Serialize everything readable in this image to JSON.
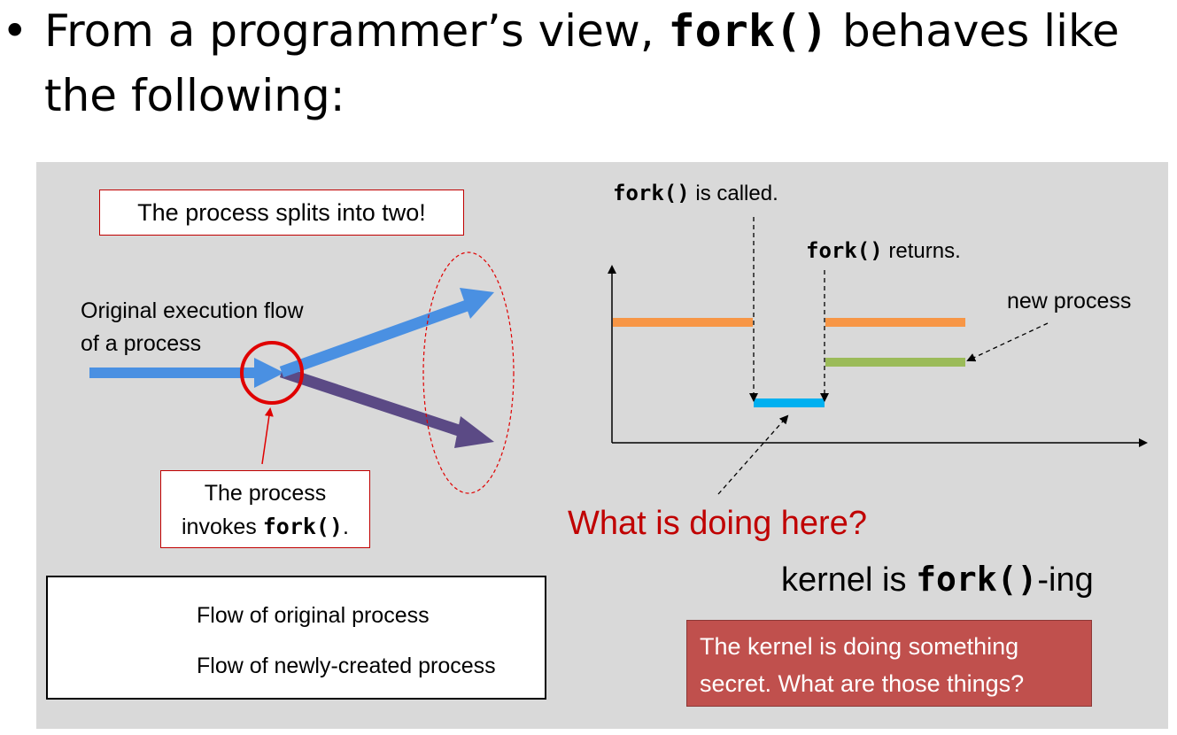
{
  "title": {
    "bullet": "•",
    "line1_prefix": "From a programmer’s view, ",
    "line1_code": "fork()",
    "line1_suffix": " behaves like",
    "line2": "the following:"
  },
  "left": {
    "split_box": "The process splits into two!",
    "flow_label_1": "Original execution flow",
    "flow_label_2": "of a process",
    "invoke_line1": "The process",
    "invoke_prefix": "invokes ",
    "invoke_code": "fork()",
    "invoke_suffix": "."
  },
  "legend": {
    "items": [
      {
        "label": "Flow of original process",
        "color": "#4a90e2"
      },
      {
        "label": "Flow of newly-created process",
        "color": "#c0504d"
      }
    ]
  },
  "timeline": {
    "called_code": "fork()",
    "called_text": " is called.",
    "returns_code": "fork()",
    "returns_text": " returns.",
    "new_process": "new process",
    "question": "What is doing here?",
    "answer_prefix": "kernel is ",
    "answer_code": "fork()",
    "answer_suffix": "-ing"
  },
  "secret_box": {
    "line1": "The kernel is doing something",
    "line2": "secret. What are those things?"
  },
  "colors": {
    "original_flow": "#4a90e2",
    "new_flow": "#5b4a85",
    "orange_segment": "#f79646",
    "green_segment": "#9bbb59",
    "kernel_segment": "#00b0f0",
    "question_red": "#c00000"
  }
}
